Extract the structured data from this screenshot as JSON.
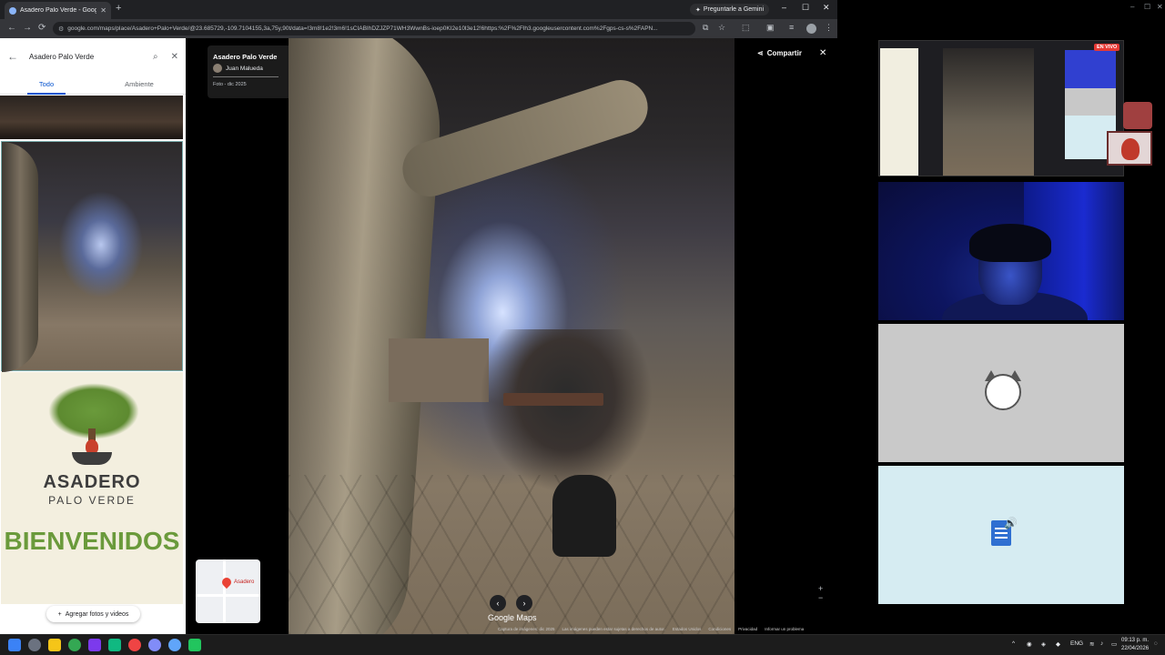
{
  "browser": {
    "tab_title": "Asadero Palo Verde - Google M",
    "new_tab": "+",
    "gemini_label": "Preguntarle a Gemini",
    "url": "google.com/maps/place/Asadero+Palo+Verde/@23.685729,-109.7104155,3a,75y,90t/data=!3m8!1e2!3m6!1sCIABIhDZJZP71WH3WwnBs-ioep0KI2e10l3e12!6https:%2F%2Flh3.googleusercontent.com%2Fgps-cs-s%2FAPN..."
  },
  "panel": {
    "search_query": "Asadero Palo Verde",
    "tabs": [
      "Todo",
      "Ambiente"
    ],
    "active_tab": "Todo",
    "brand_line1": "ASADERO",
    "brand_line2": "PALO VERDE",
    "welcome": "BIENVENIDOS",
    "add_photos": "Agregar fotos y videos"
  },
  "viewer": {
    "place_name": "Asadero Palo Verde",
    "author": "Juan Malueda",
    "photo_date": "Foto - dic 2025",
    "share_label": "Compartir",
    "brand": "Google Maps",
    "minimap_label": "Asadero",
    "footer": [
      "Captura de imágenes: dic 2025",
      "Las imágenes pueden estar sujetas a derechos de autor.",
      "Estados Unidos",
      "Condiciones",
      "Privacidad",
      "Informar un problema"
    ]
  },
  "stream": {
    "live_badge": "EN VIVO"
  },
  "taskbar": {
    "language": "ENG",
    "time": "09:13 p. m.",
    "date": "22/04/2026"
  },
  "colors": {
    "accent_blue": "#0b57d0",
    "live_red": "#e53935",
    "brand_green": "#6a9a3b"
  }
}
